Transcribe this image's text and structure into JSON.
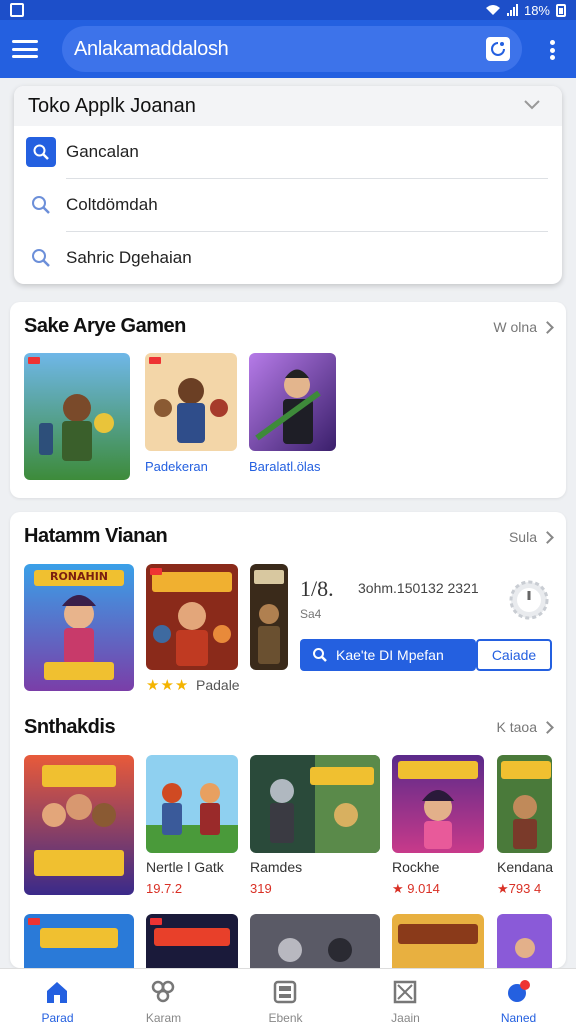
{
  "status_bar": {
    "battery_text": "18%"
  },
  "app_bar": {
    "search_text": "Anlakamaddalosh"
  },
  "dropdown": {
    "title": "Toko Applk Joanan",
    "items": [
      {
        "label": "Gancalan",
        "icon": "search-icon",
        "active": true
      },
      {
        "label": "Coltdömdah",
        "icon": "search-icon",
        "active": false
      },
      {
        "label": "Sahric Dgehaian",
        "icon": "search-icon",
        "active": false
      }
    ]
  },
  "section1": {
    "title": "Sake Arye Gamen",
    "see_all": "W olna",
    "items": [
      {
        "label": ""
      },
      {
        "label": "Padekeran"
      },
      {
        "label": "Baralatl.ölas"
      }
    ]
  },
  "section2": {
    "title": "Hatamm Vianan",
    "see_all": "Sula",
    "featured_title": "RONAHIN",
    "rating_label": "Padale",
    "stat_a": "1/8.",
    "stat_b": "3ohm.150132 2321",
    "stat_sub": "Sa4",
    "primary_button": "Kae'te DI Mpefan",
    "secondary_button": "Caiade"
  },
  "section3": {
    "title": "Snthakdis",
    "see_all": "K taoa",
    "items": [
      {
        "name": "",
        "price": ""
      },
      {
        "name": "Nertle l Gatk",
        "price": "19.7.2"
      },
      {
        "name": "Ramdes",
        "price": "319"
      },
      {
        "name": "Rockhe",
        "price": "★ 9.014"
      },
      {
        "name": "Kendana",
        "price": "★793 4"
      }
    ]
  },
  "bottom_nav": [
    {
      "label": "Parad",
      "icon": "home-icon",
      "active": true
    },
    {
      "label": "Karam",
      "icon": "games-icon",
      "active": false
    },
    {
      "label": "Ebenk",
      "icon": "apps-icon",
      "active": false
    },
    {
      "label": "Jaain",
      "icon": "library-icon",
      "active": false
    },
    {
      "label": "Naned",
      "icon": "profile-icon",
      "active": false
    }
  ],
  "colors": {
    "primary": "#2460e0",
    "status_bar": "#1d4fc9",
    "star": "#f4b400",
    "price": "#d93025"
  }
}
